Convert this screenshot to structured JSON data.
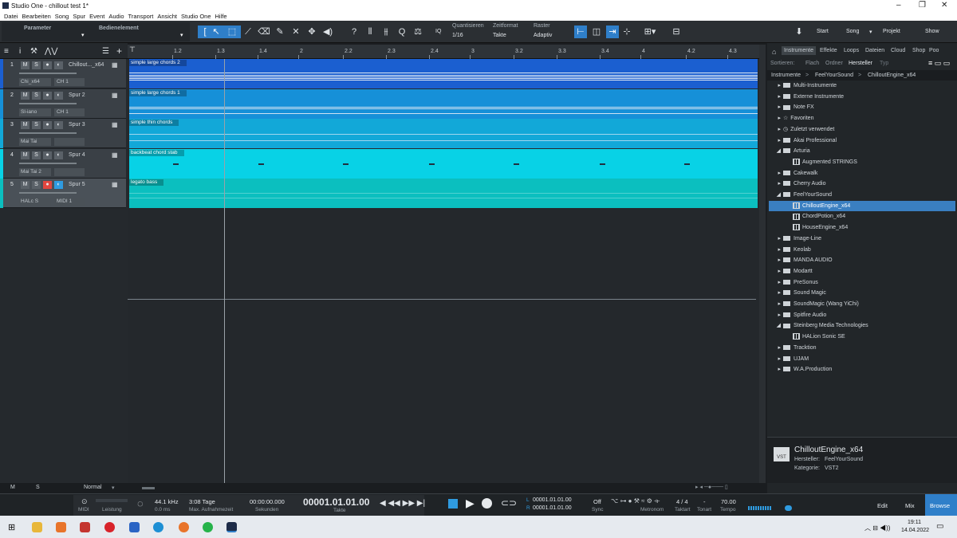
{
  "window": {
    "title": "Studio One - chillout test 1*",
    "min": "–",
    "max": "❐",
    "close": "✕"
  },
  "menu": [
    "Datei",
    "Bearbeiten",
    "Song",
    "Spur",
    "Event",
    "Audio",
    "Transport",
    "Ansicht",
    "Studio One",
    "Hilfe"
  ],
  "toolbar": {
    "parameter": "Parameter",
    "bedienelement": "Bedienelement",
    "quantisieren_label": "Quantisieren",
    "quantisieren_value": "1/16",
    "zeitformat_label": "Zeitformat",
    "zeitformat_value": "Takte",
    "raster_label": "Raster",
    "raster_value": "Adaptiv",
    "iq": "IQ",
    "start": "Start",
    "song": "Song",
    "projekt": "Projekt",
    "show": "Show"
  },
  "ruler": [
    "1.2",
    "1.3",
    "1.4",
    "2",
    "2.2",
    "2.3",
    "2.4",
    "3",
    "3.2",
    "3.3",
    "3.4",
    "4",
    "4.2",
    "4.3"
  ],
  "tracks": [
    {
      "num": "1",
      "name": "Chillout..._x64",
      "inst": "Chi_x64",
      "ch": "CH 1",
      "color": "#1b5fd0",
      "event": "simple large chords 2"
    },
    {
      "num": "2",
      "name": "Spur 2",
      "inst": "Sl-iano",
      "ch": "CH 1",
      "color": "#1690d8",
      "event": "simple large chords 1"
    },
    {
      "num": "3",
      "name": "Spur 3",
      "inst": "Mai Tai",
      "ch": "",
      "color": "#12a8d8",
      "event": "simple thin chords"
    },
    {
      "num": "4",
      "name": "Spur 4",
      "inst": "Mai Tai 2",
      "ch": "",
      "color": "#08d2e6",
      "event": "backbeat chord stab"
    },
    {
      "num": "5",
      "name": "Spur 5",
      "inst": "HALc S",
      "ch": "MIDI 1",
      "color": "#0bbfbf",
      "event": "legato bass"
    }
  ],
  "track_buttons": {
    "m": "M",
    "s": "S"
  },
  "browser": {
    "tabs": [
      "Instrumente",
      "Effekte",
      "Loops",
      "Dateien",
      "Cloud",
      "Shop",
      "Poo"
    ],
    "sort_label": "Sortieren:",
    "sort_options": [
      "Flach",
      "Ordner",
      "Hersteller",
      "Typ"
    ],
    "breadcrumb": [
      "Instrumente",
      ">",
      "FeelYourSound",
      ">",
      "ChilloutEngine_x64"
    ],
    "items": [
      "Multi-Instrumente",
      "Externe Instrumente",
      "Note FX",
      "Favoriten",
      "Zuletzt verwendet",
      "Akai Professional",
      "Arturia",
      "Augmented STRINGS",
      "Cakewalk",
      "Cherry Audio",
      "FeelYourSound",
      "ChilloutEngine_x64",
      "ChordPotion_x64",
      "HouseEngine_x64",
      "Image-Line",
      "Keolab",
      "MANDA AUDIO",
      "Modartt",
      "PreSonus",
      "Sound Magic",
      "SoundMagic (Wang YiChi)",
      "Spitfire Audio",
      "Steinberg Media Technologies",
      "HALion Sonic SE",
      "Tracktion",
      "UJAM",
      "W.A.Production"
    ],
    "info_name": "ChilloutEngine_x64",
    "info_vendor_label": "Hersteller:",
    "info_vendor": "FeelYourSound",
    "info_cat_label": "Kategorie:",
    "info_cat": "VST2",
    "info_badge": "VST"
  },
  "bottom": {
    "m": "M",
    "s": "S",
    "mode": "Normal"
  },
  "transport": {
    "midi": "MIDI",
    "leistung": "Leistung",
    "rate": "44.1 kHz",
    "latency": "0.0 ms",
    "days": "3:08 Tage",
    "maxrec": "Max. Aufnahmezeit",
    "sec_val": "00:00:00.000",
    "sec_label": "Sekunden",
    "bars_val": "00001.01.01.00",
    "bars_label": "Takte",
    "l_val": "00001.01.01.00",
    "r_val": "00001.01.01.00",
    "l": "L",
    "r": "R",
    "sync_val": "Off",
    "sync": "Sync",
    "metronom": "Metronom",
    "taktart_val": "4 / 4",
    "taktart": "Taktart",
    "tonart_val": "-",
    "tonart": "Tonart",
    "tempo_val": "70.00",
    "tempo": "Tempo",
    "edit": "Edit",
    "mix": "Mix",
    "browse": "Browse"
  },
  "taskbar": {
    "time": "19:11",
    "date": "14.04.2022"
  }
}
